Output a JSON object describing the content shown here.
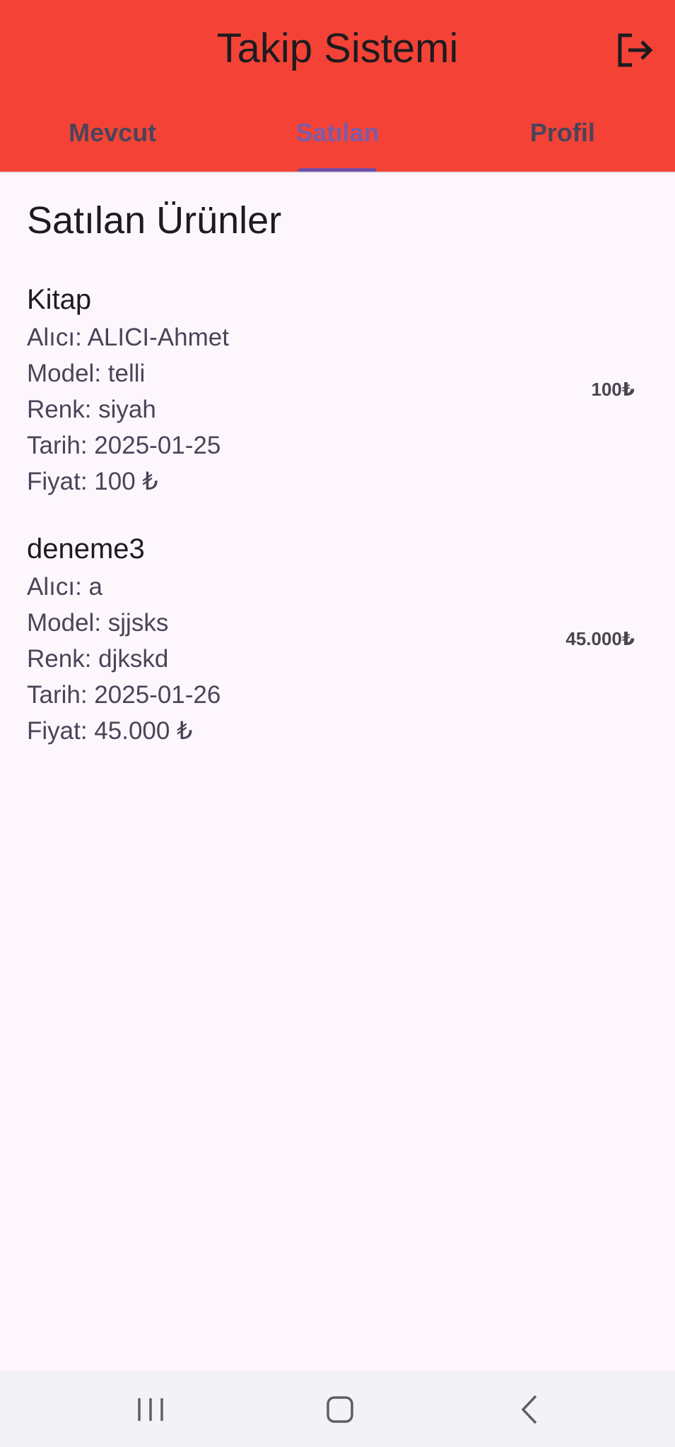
{
  "app_bar": {
    "title": "Takip Sistemi",
    "logout_icon": "logout-icon"
  },
  "tabs": [
    {
      "label": "Mevcut",
      "active": false
    },
    {
      "label": "Satılan",
      "active": true
    },
    {
      "label": "Profil",
      "active": false
    }
  ],
  "page_title": "Satılan Ürünler",
  "items": [
    {
      "name": "Kitap",
      "buyer": "Alıcı: ALICI-Ahmet",
      "model": "Model: telli",
      "color": "Renk: siyah",
      "date": "Tarih: 2025-01-25",
      "price_line": "Fiyat: 100 ₺",
      "price_trailing": "100₺"
    },
    {
      "name": "deneme3",
      "buyer": "Alıcı: a",
      "model": "Model: sjjsks",
      "color": "Renk: djkskd",
      "date": "Tarih: 2025-01-26",
      "price_line": "Fiyat: 45.000 ₺",
      "price_trailing": "45.000₺"
    }
  ],
  "system_nav": {
    "recents_icon": "recents-icon",
    "home_icon": "home-icon",
    "back_icon": "back-icon"
  },
  "colors": {
    "app_bar": "#f44336",
    "background": "#fdf7fd",
    "tab_active": "#7d5ca5",
    "tab_inactive": "#4a4459",
    "indicator": "#6f4ea6"
  }
}
